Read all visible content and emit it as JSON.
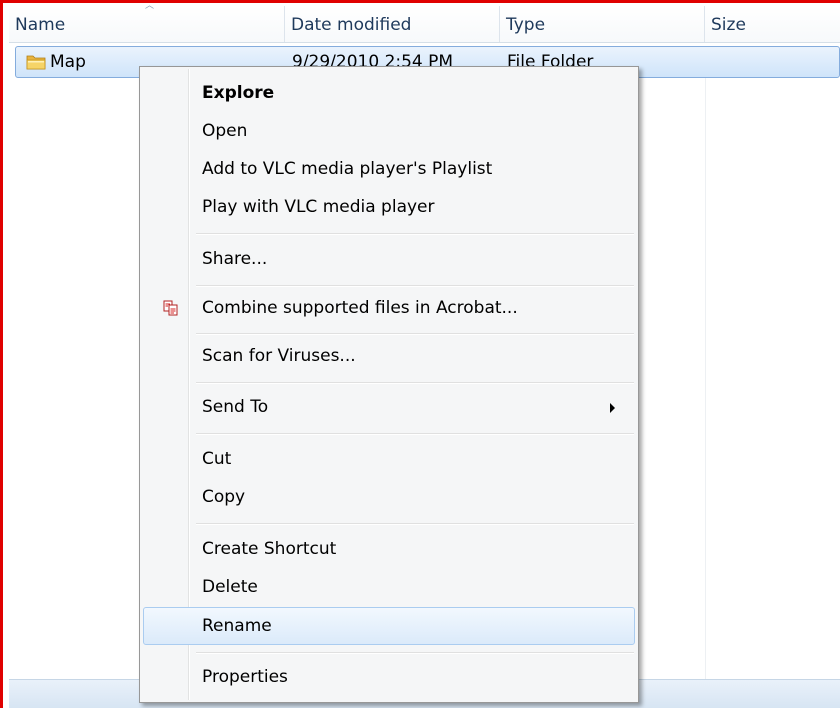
{
  "columns": {
    "name": "Name",
    "date_modified": "Date modified",
    "type": "Type",
    "size": "Size"
  },
  "files": [
    {
      "name": "Map",
      "date_modified": "9/29/2010 2:54 PM",
      "type": "File Folder",
      "size": "",
      "icon": "folder-icon",
      "selected": true
    }
  ],
  "context_menu": {
    "items": [
      {
        "label": "Explore",
        "default": true
      },
      {
        "label": "Open"
      },
      {
        "label": "Add to VLC media player's Playlist"
      },
      {
        "label": "Play with VLC media player"
      },
      {
        "label": "Share..."
      },
      {
        "label": "Combine supported files in Acrobat...",
        "icon": "acrobat-combine-icon"
      },
      {
        "label": "Scan for Viruses..."
      },
      {
        "label": "Send To",
        "submenu": true
      },
      {
        "label": "Cut"
      },
      {
        "label": "Copy"
      },
      {
        "label": "Create Shortcut"
      },
      {
        "label": "Delete"
      },
      {
        "label": "Rename",
        "hovered": true
      },
      {
        "label": "Properties"
      }
    ]
  },
  "colors": {
    "highlight_border": "#e00000",
    "selection": "#cfe4fa",
    "menu_background": "#f5f6f7"
  }
}
